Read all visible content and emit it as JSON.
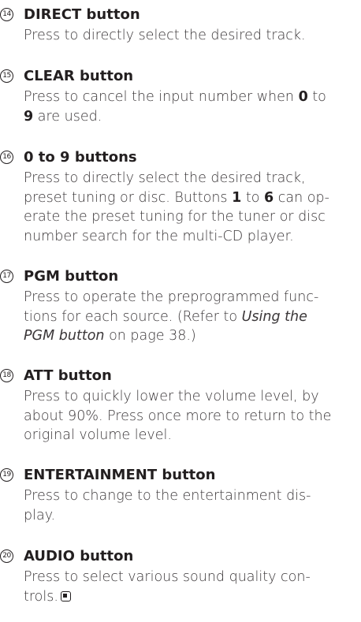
{
  "entries": [
    {
      "number": "14",
      "title": "DIRECT button",
      "lines": [
        "Press to directly select the desired track."
      ]
    },
    {
      "number": "15",
      "title": "CLEAR button",
      "lines": [
        {
          "a": "Press to cancel the input number when ",
          "b": "0",
          "c": " to"
        },
        {
          "b": "9",
          "c": " are used."
        }
      ]
    },
    {
      "number": "16",
      "title": "0 to 9 buttons",
      "lines": [
        "Press to directly select the desired track,",
        {
          "a": "preset tuning or disc. Buttons ",
          "b": "1",
          "c": " to ",
          "d": "6",
          "e": " can op-"
        },
        "erate the preset tuning for the tuner or disc",
        "number search for the multi-CD player."
      ]
    },
    {
      "number": "17",
      "title": "PGM button",
      "lines": [
        "Press to operate the preprogrammed func-",
        {
          "a": "tions for each source. (Refer to ",
          "i": "Using the"
        },
        {
          "i": "PGM button",
          "c": " on page 38.)"
        }
      ]
    },
    {
      "number": "18",
      "title": "ATT button",
      "lines": [
        "Press to quickly lower the volume level, by",
        "about 90%. Press once more to return to the",
        "original volume level."
      ]
    },
    {
      "number": "19",
      "title": "ENTERTAINMENT button",
      "lines": [
        "Press to change to the entertainment dis-",
        "play."
      ]
    },
    {
      "number": "20",
      "title": "AUDIO button",
      "lines": [
        "Press to select various sound quality con-",
        "trols."
      ]
    }
  ]
}
